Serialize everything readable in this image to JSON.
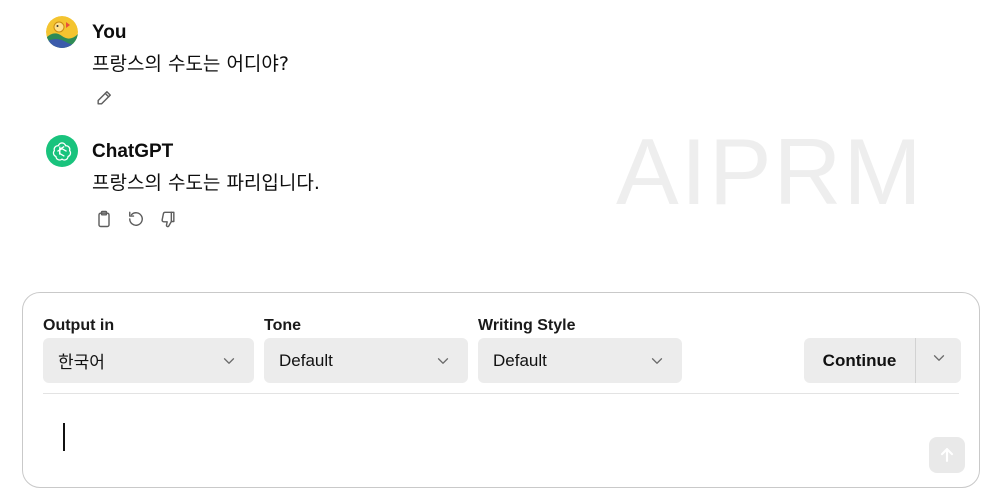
{
  "watermark": "AIPRM",
  "conversation": {
    "user": {
      "author": "You",
      "text": "프랑스의 수도는 어디야?",
      "avatar_icon": "user-avatar-icon",
      "actions": [
        {
          "icon": "pencil-edit-icon"
        }
      ]
    },
    "assistant": {
      "author": "ChatGPT",
      "text": "프랑스의 수도는 파리입니다.",
      "avatar_icon": "openai-logo-icon",
      "actions": [
        {
          "icon": "clipboard-copy-icon"
        },
        {
          "icon": "regenerate-icon"
        },
        {
          "icon": "thumbs-down-icon"
        }
      ]
    }
  },
  "composer": {
    "output": {
      "label": "Output in",
      "value": "한국어"
    },
    "tone": {
      "label": "Tone",
      "value": "Default"
    },
    "style": {
      "label": "Writing Style",
      "value": "Default"
    },
    "continue_label": "Continue",
    "prompt_placeholder": "",
    "send_icon": "arrow-up-icon"
  },
  "colors": {
    "accent": "#19c37d",
    "control_bg": "#ececec",
    "watermark": "#eeeeee"
  }
}
